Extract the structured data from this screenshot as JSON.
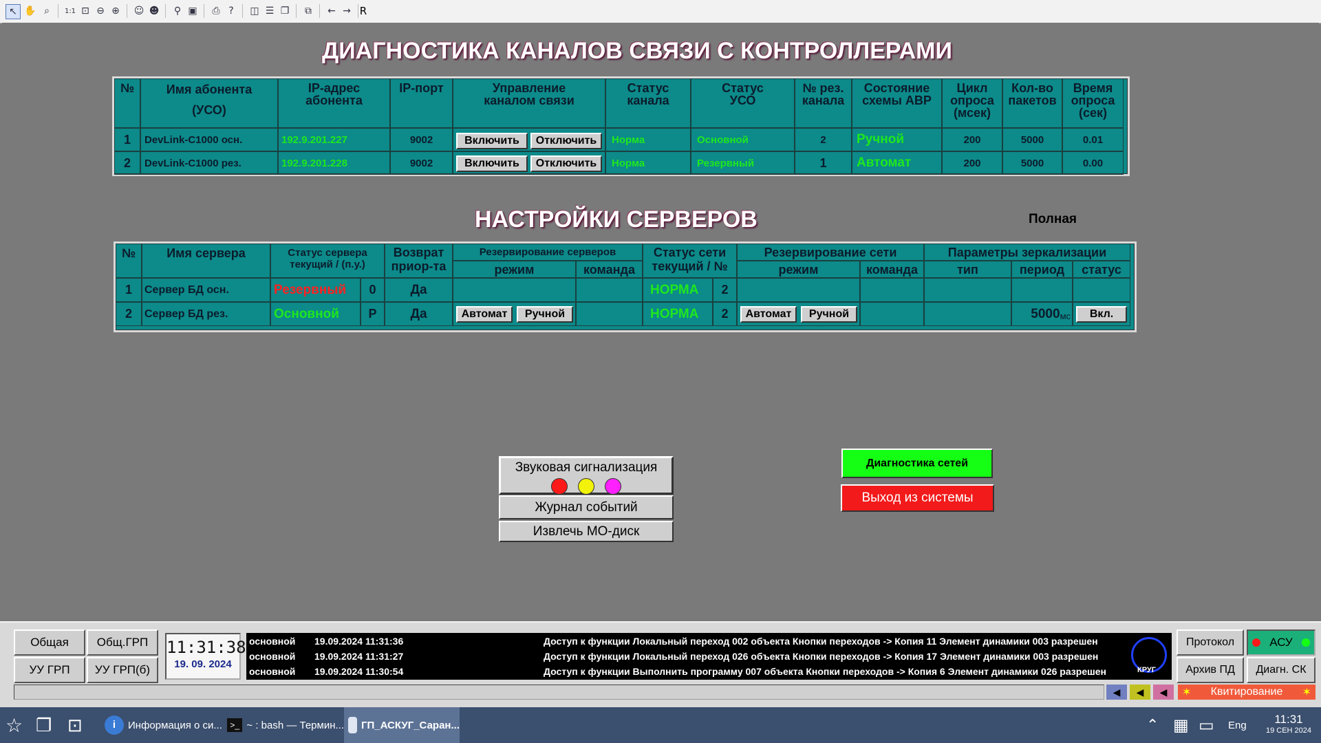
{
  "toolbar": {
    "last_label": "R"
  },
  "channels": {
    "title": "ДИАГНОСТИКА КАНАЛОВ СВЯЗИ С КОНТРОЛЛЕРАМИ",
    "headers": {
      "num": "№",
      "name": "Имя абонента\n(УСО)",
      "ip": "IP-адрес\nабонента",
      "port": "IP-порт",
      "control": "Управление\nканалом связи",
      "channel_status": "Статус\nканала",
      "uso_status": "Статус\nУСО",
      "res_channel": "№ рез.\nканала",
      "avr": "Состояние\nсхемы АВР",
      "cycle": "Цикл\nопроса\n(мсек)",
      "packets": "Кол-во\nпакетов",
      "poll_time": "Время\nопроса\n(сек)"
    },
    "rows": [
      {
        "num": "1",
        "name": "DevLink-C1000 осн.",
        "ip": "192.9.201.227",
        "port": "9002",
        "btn_on": "Включить",
        "btn_off": "Отключить",
        "channel_status": "Норма",
        "uso_status": "Основной",
        "res_channel": "2",
        "avr": "Ручной",
        "cycle": "200",
        "packets": "5000",
        "poll_time": "0.01"
      },
      {
        "num": "2",
        "name": "DevLink-C1000 рез.",
        "ip": "192.9.201.228",
        "port": "9002",
        "btn_on": "Включить",
        "btn_off": "Отключить",
        "channel_status": "Норма",
        "uso_status": "Резервный",
        "res_channel": "1",
        "avr": "Автомат",
        "cycle": "200",
        "packets": "5000",
        "poll_time": "0.00"
      }
    ]
  },
  "servers": {
    "title": "НАСТРОЙКИ СЕРВЕРОВ",
    "mode_label": "Полная",
    "headers": {
      "num": "№",
      "name": "Имя сервера",
      "status": "Статус сервера\nтекущий / (п.у.)",
      "return": "Возврат\nприор-та",
      "reserve_srv": "Резервирование серверов",
      "mode": "режим",
      "command": "команда",
      "net_status": "Статус сети\nтекущий / №",
      "reserve_net": "Резервирование сети",
      "mirror": "Параметры зеркализации",
      "type": "тип",
      "period": "период",
      "mstatus": "статус"
    },
    "rows": [
      {
        "num": "1",
        "name": "Сервер БД осн.",
        "status": "Резервный",
        "pu": "0",
        "return": "Да",
        "net": "НОРМА",
        "net_num": "2"
      },
      {
        "num": "2",
        "name": "Сервер БД рез.",
        "status": "Основной",
        "pu": "Р",
        "return": "Да",
        "btn_auto": "Автомат",
        "btn_manual": "Ручной",
        "net": "НОРМА",
        "net_num": "2",
        "net_btn_auto": "Автомат",
        "net_btn_manual": "Ручной",
        "period": "5000",
        "period_unit": "мс",
        "mirror_btn": "Вкл."
      }
    ]
  },
  "controls": {
    "sound": "Звуковая сигнализация",
    "journal": "Журнал событий",
    "eject": "Извлечь МО-диск",
    "net_diag": "Диагностика сетей",
    "logout": "Выход из системы",
    "colors": {
      "red": "#ff1a1a",
      "yellow": "#f2f20a",
      "magenta": "#ff20ff",
      "green_btn": "#15ff15",
      "red_btn": "#f21a1a"
    }
  },
  "bottom": {
    "btn_general": "Общая",
    "btn_general_grp": "Общ.ГРП",
    "btn_uu_grp": "УУ ГРП",
    "btn_uu_grp6": "УУ ГРП(б)",
    "clock_time": "11:31:38",
    "clock_date": "19. 09. 2024",
    "log": [
      {
        "src": "основной",
        "ts": "19.09.2024 11:31:36",
        "msg": "Доступ к функции Локальный переход 002 объекта Кнопки переходов -> Копия 11 Элемент динамики 003 разрешен"
      },
      {
        "src": "основной",
        "ts": "19.09.2024 11:31:27",
        "msg": "Доступ к функции Локальный переход 026 объекта Кнопки переходов -> Копия 17 Элемент динамики 003 разрешен"
      },
      {
        "src": "основной",
        "ts": "19.09.2024 11:30:54",
        "msg": "Доступ к функции Выполнить программу 007 объекта Кнопки переходов -> Копия 6 Элемент динамики 026 разрешен"
      }
    ],
    "logo": "КРУГ",
    "btn_protocol": "Протокол",
    "asu": "АСУ",
    "btn_archive": "Архив ПД",
    "btn_diag_sk": "Диагн. СК",
    "ack": "Квитирование"
  },
  "taskbar": {
    "app1": "Информация о си...",
    "app2": "~ : bash — Термин...",
    "app3": "ГП_АСКУГ_Саран...",
    "lang": "Eng",
    "time": "11:31",
    "date": "19 СЕН 2024"
  }
}
